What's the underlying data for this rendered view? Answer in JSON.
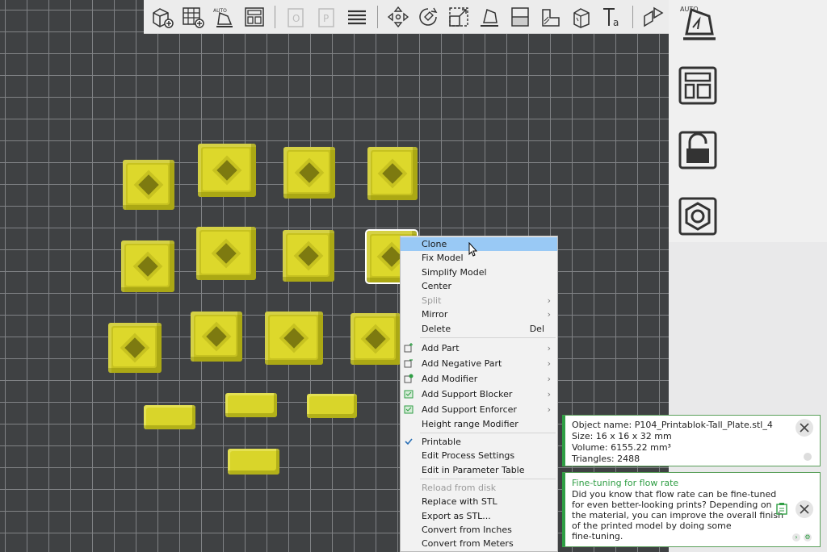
{
  "toolbar": {
    "icons": [
      "add-object-icon",
      "add-plate-icon",
      "auto-orient-icon",
      "arrange-icon",
      "split-objects-icon",
      "split-parts-icon",
      "layers-list-icon",
      "move-icon",
      "rotate-icon",
      "scale-icon",
      "lay-on-face-icon",
      "cut-icon",
      "seam-paint-icon",
      "support-paint-icon",
      "text-icon",
      "assembly-icon"
    ]
  },
  "right_toolbar": {
    "icons": [
      "auto-orient-icon",
      "arrange-icon",
      "lock-icon",
      "nut-settings-icon"
    ]
  },
  "context_menu": {
    "items": [
      {
        "label": "Clone",
        "highlighted": true
      },
      {
        "label": "Fix Model"
      },
      {
        "label": "Simplify Model"
      },
      {
        "label": "Center"
      },
      {
        "label": "Split",
        "disabled": true,
        "submenu": true
      },
      {
        "label": "Mirror",
        "submenu": true
      },
      {
        "label": "Delete",
        "shortcut": "Del"
      },
      {
        "label": "Add Part",
        "submenu": true
      },
      {
        "label": "Add Negative Part",
        "submenu": true
      },
      {
        "label": "Add Modifier",
        "submenu": true
      },
      {
        "label": "Add Support Blocker",
        "submenu": true
      },
      {
        "label": "Add Support Enforcer",
        "submenu": true
      },
      {
        "label": "Height range Modifier"
      },
      {
        "label": "Printable",
        "checked": true
      },
      {
        "label": "Edit Process Settings"
      },
      {
        "label": "Edit in Parameter Table"
      },
      {
        "label": "Reload from disk",
        "disabled": true
      },
      {
        "label": "Replace with STL"
      },
      {
        "label": "Export as STL..."
      },
      {
        "label": "Convert from Inches"
      },
      {
        "label": "Convert from Meters"
      }
    ]
  },
  "object_info": {
    "name": "Object name: P104_Printablok-Tall_Plate.stl_4",
    "size": "Size: 16 x 16 x 32 mm",
    "volume": "Volume: 6155.22 mm³",
    "triangles": "Triangles: 2488"
  },
  "tip": {
    "title": "Fine-tuning for flow rate",
    "lines": [
      "Did you know that flow rate can be fine-tuned",
      "for even better-looking prints? Depending on",
      "the material, you can improve the overall finish",
      "of the printed model by doing some",
      "fine-tuning."
    ]
  },
  "colors": {
    "accent_green": "#2f9e44",
    "menu_highlight": "#99c9f5",
    "model_yellow": "#ddd82b",
    "plate_dark": "#3f4143"
  }
}
